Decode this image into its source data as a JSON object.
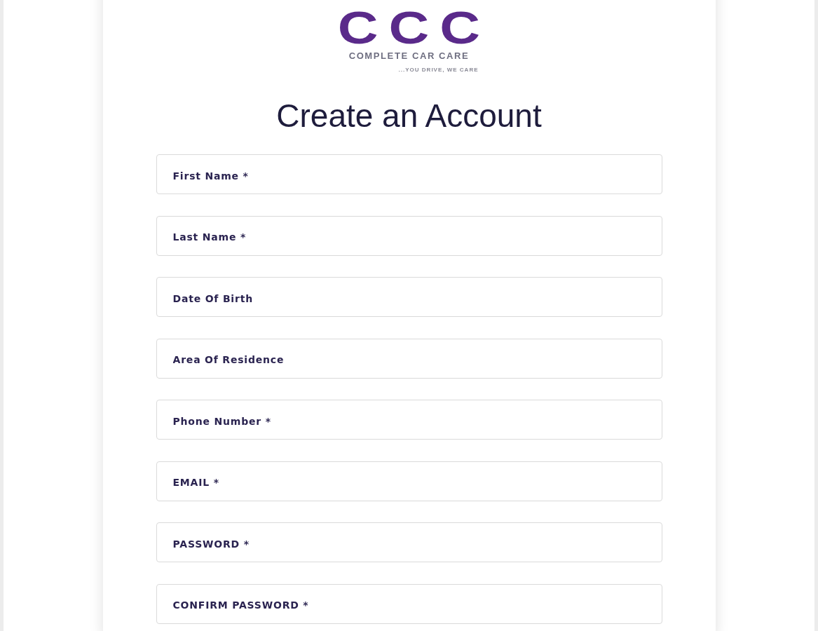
{
  "logo": {
    "mark": "CCC",
    "name": "COMPLETE CAR CARE",
    "slogan": "...YOU DRIVE, WE CARE"
  },
  "title": "Create an Account",
  "fields": [
    {
      "placeholder": "First Name *"
    },
    {
      "placeholder": "Last Name *"
    },
    {
      "placeholder": "Date Of Birth"
    },
    {
      "placeholder": "Area Of Residence"
    },
    {
      "placeholder": "Phone Number *"
    },
    {
      "placeholder": "EMAIL *"
    },
    {
      "placeholder": "PASSWORD *"
    },
    {
      "placeholder": "CONFIRM PASSWORD *"
    }
  ]
}
